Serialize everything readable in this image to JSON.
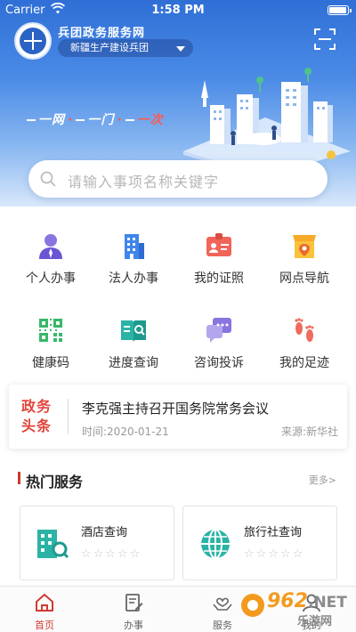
{
  "status_bar": {
    "carrier": "Carrier",
    "time": "1:58 PM"
  },
  "header": {
    "title": "兵团政务服务网",
    "region": "新疆生产建设兵团"
  },
  "slogan": {
    "part1": "一网",
    "part2": "一门",
    "part3": "一次"
  },
  "search": {
    "placeholder": "请输入事项名称关键字"
  },
  "services": [
    {
      "label": "个人办事",
      "icon": "person-icon"
    },
    {
      "label": "法人办事",
      "icon": "building-icon"
    },
    {
      "label": "我的证照",
      "icon": "id-card-icon"
    },
    {
      "label": "网点导航",
      "icon": "store-location-icon"
    },
    {
      "label": "健康码",
      "icon": "qr-code-icon"
    },
    {
      "label": "进度查询",
      "icon": "progress-book-icon"
    },
    {
      "label": "咨询投诉",
      "icon": "chat-bubble-icon"
    },
    {
      "label": "我的足迹",
      "icon": "footprints-icon"
    }
  ],
  "news": {
    "badge_line1": "政务",
    "badge_line2": "头条",
    "headline": "李克强主持召开国务院常务会议",
    "date": "时间:2020-01-21",
    "source": "来源:新华社"
  },
  "hot_services": {
    "title": "热门服务",
    "more": "更多>",
    "items": [
      {
        "name": "酒店查询",
        "stars": "☆☆☆☆☆",
        "rating": 0,
        "icon": "hotel-search-icon"
      },
      {
        "name": "旅行社查询",
        "stars": "☆☆☆☆☆",
        "rating": 0,
        "icon": "globe-icon"
      }
    ]
  },
  "tabs": [
    {
      "label": "首页",
      "active": true,
      "icon": "home-icon"
    },
    {
      "label": "办事",
      "active": false,
      "icon": "document-edit-icon"
    },
    {
      "label": "服务",
      "active": false,
      "icon": "heart-hands-icon"
    },
    {
      "label": "我的",
      "active": false,
      "icon": "user-icon"
    }
  ],
  "watermark": {
    "number": "962",
    "suffix": ".NET",
    "subtitle": "乐游网"
  },
  "colors": {
    "primary_blue": "#2f6fd6",
    "accent_red": "#d03a33",
    "teal": "#2bb3a5"
  }
}
